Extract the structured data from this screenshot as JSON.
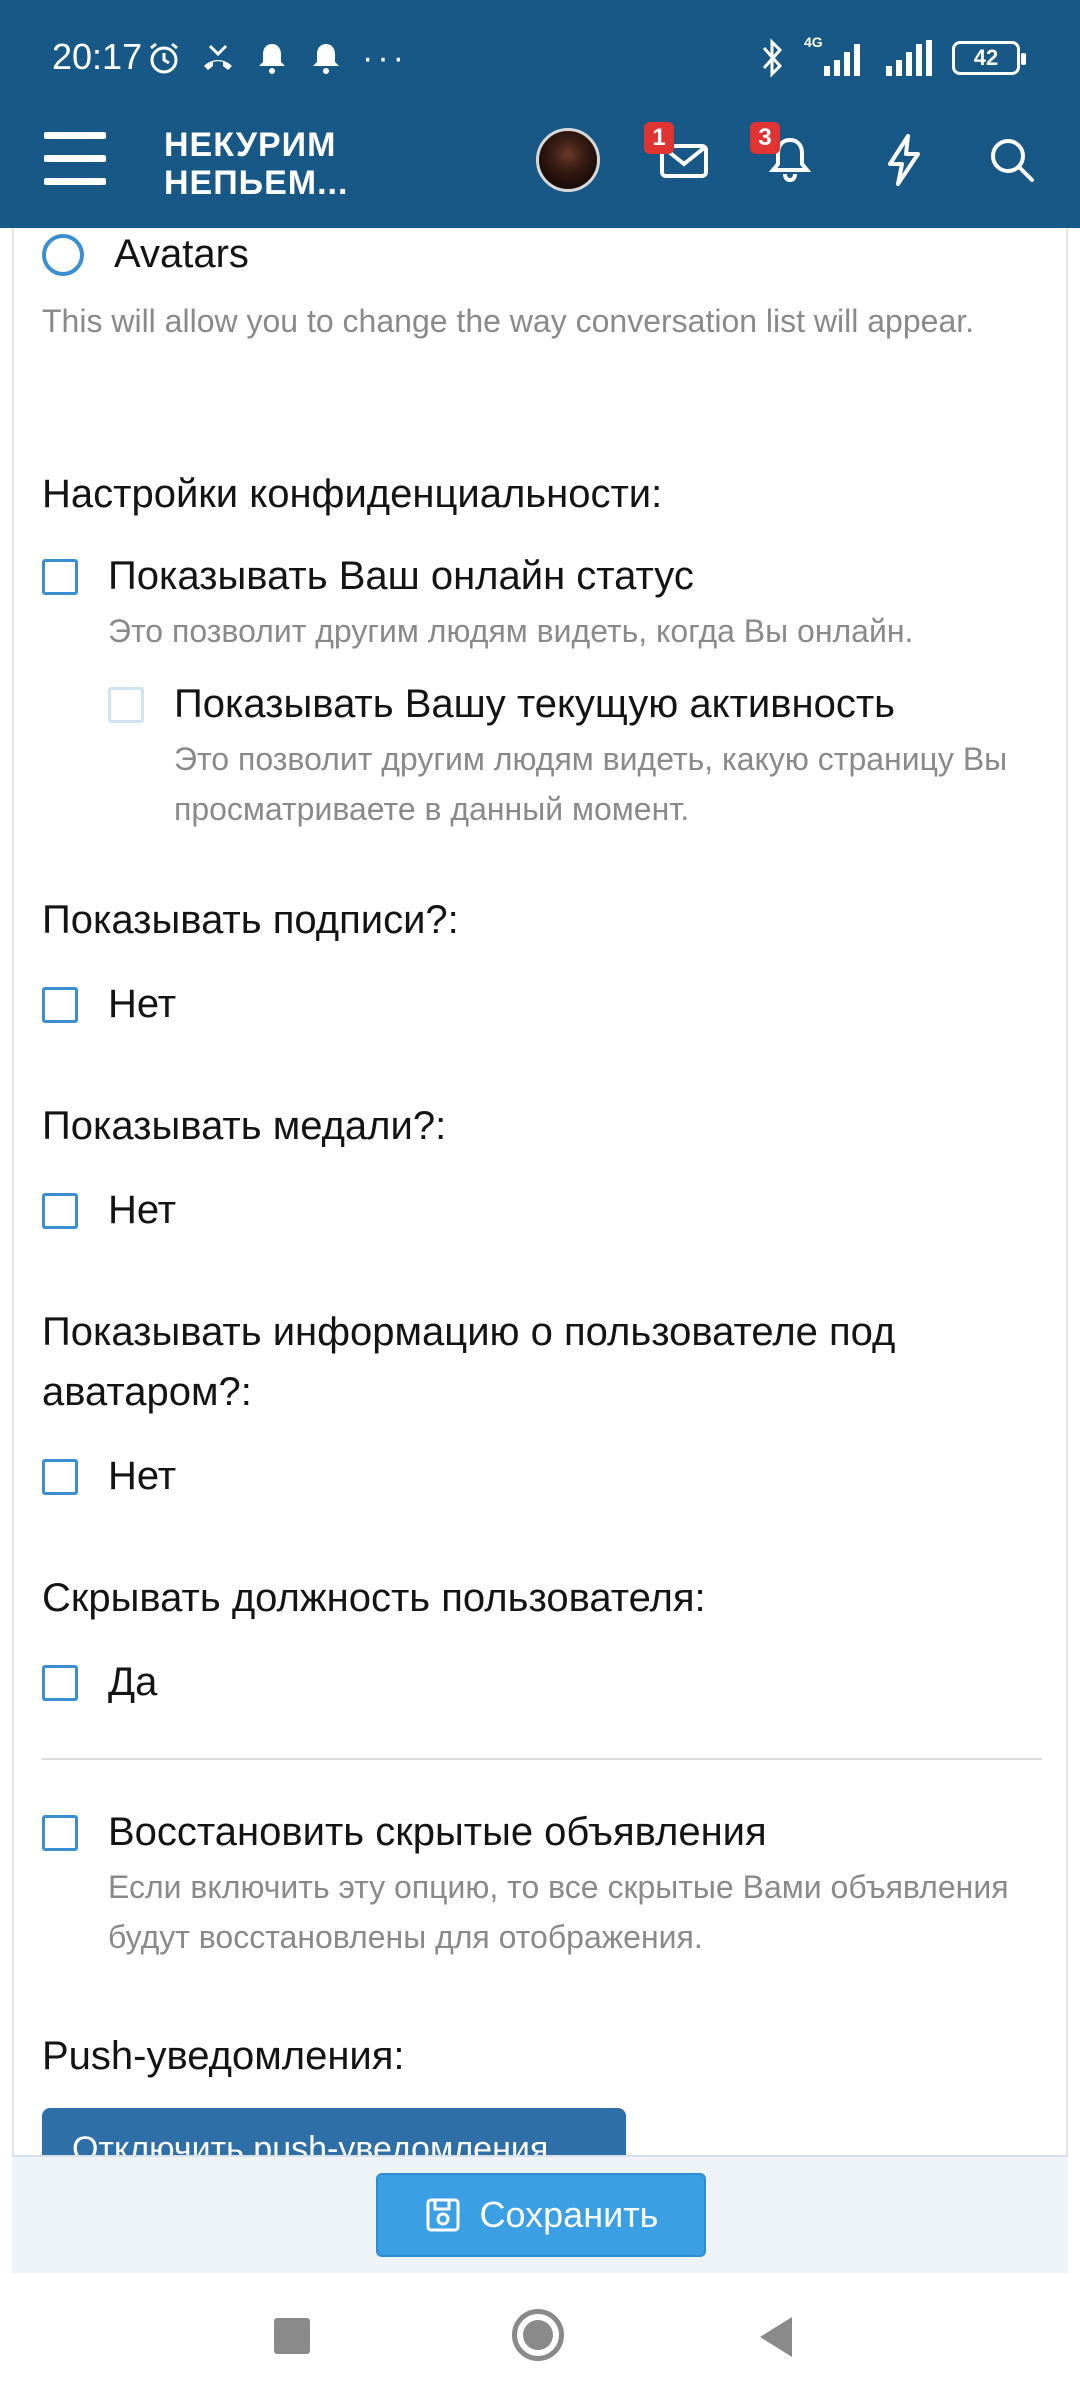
{
  "status_bar": {
    "time": "20:17",
    "network": "4G",
    "battery": "42"
  },
  "app_bar": {
    "logo_line1": "НЕКУРИМ",
    "logo_line2": "НЕПЬЕМ...",
    "messages_badge": "1",
    "alerts_badge": "3"
  },
  "content": {
    "avatars_option": "Avatars",
    "avatars_hint": "This will allow you to change the way conversation list will appear.",
    "privacy_heading": "Настройки конфиденциальности:",
    "online_status_label": "Показывать Ваш онлайн статус",
    "online_status_hint": "Это позволит другим людям видеть, когда Вы онлайн.",
    "activity_label": "Показывать Вашу текущую активность",
    "activity_hint": "Это позволит другим людям видеть, какую страницу Вы просматриваете в данный момент.",
    "signatures_heading": "Показывать подписи?:",
    "signatures_label": "Нет",
    "medals_heading": "Показывать медали?:",
    "medals_label": "Нет",
    "userinfo_heading": "Показывать информацию о пользователе под аватаром?:",
    "userinfo_label": "Нет",
    "hide_title_heading": "Скрывать должность пользователя:",
    "hide_title_label": "Да",
    "restore_notices_label": "Восстановить скрытые объявления",
    "restore_notices_hint": "Если включить эту опцию, то все скрытые Вами объявления будут восстановлены для отображения.",
    "push_heading": "Push-уведомления:",
    "push_button": "Отключить push-уведомления"
  },
  "footer": {
    "save_button": "Сохранить"
  }
}
